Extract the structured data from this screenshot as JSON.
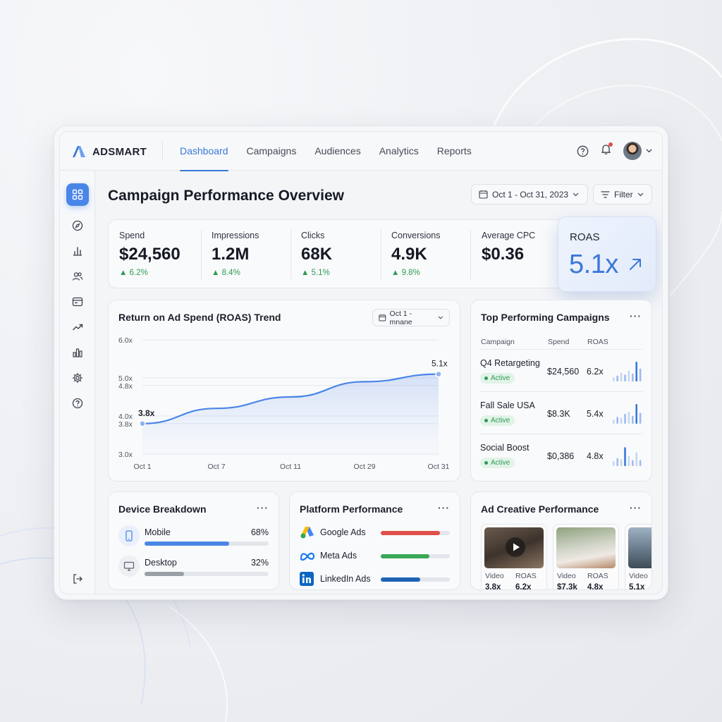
{
  "brand": {
    "name": "ADSMART",
    "accent": "#3a78d8"
  },
  "nav": {
    "items": [
      {
        "label": "Dashboard",
        "active": true
      },
      {
        "label": "Campaigns",
        "active": false
      },
      {
        "label": "Audiences",
        "active": false
      },
      {
        "label": "Analytics",
        "active": false
      },
      {
        "label": "Reports",
        "active": false
      }
    ],
    "icons": [
      "help-icon",
      "bell-icon",
      "avatar",
      "chevron-down-icon"
    ]
  },
  "sidebar": {
    "icons": [
      "grid-icon",
      "compass-icon",
      "bar-chart-icon",
      "users-icon",
      "card-icon",
      "trending-up-icon",
      "stats-icon",
      "gear-icon",
      "help-icon",
      "logout-icon"
    ]
  },
  "page": {
    "title": "Campaign Performance Overview",
    "date_range": "Oct 1 - Oct 31, 2023",
    "filter_label": "Filter"
  },
  "kpis": [
    {
      "label": "Spend",
      "value": "$24,560",
      "delta": "6.2%"
    },
    {
      "label": "Impressions",
      "value": "1.2M",
      "delta": "8.4%"
    },
    {
      "label": "Clicks",
      "value": "68K",
      "delta": "5.1%"
    },
    {
      "label": "Conversions",
      "value": "4.9K",
      "delta": "9.8%"
    },
    {
      "label": "Average CPC",
      "value": "$0.36",
      "delta": ""
    }
  ],
  "roas": {
    "label": "ROAS",
    "value": "5.1x"
  },
  "trend": {
    "title": "Return on Ad Spend (ROAS) Trend",
    "date_pill": "Oct 1 - mnane",
    "start_label": "3.8x",
    "end_label": "5.1x"
  },
  "chart_data": {
    "type": "area",
    "x": [
      "Oct 1",
      "Oct 7",
      "Oct 11",
      "Oct 29",
      "Oct 31"
    ],
    "x_ticks": [
      "Oct 1",
      "Oct 7",
      "Oct 11",
      "Oct 29",
      "Oct 31"
    ],
    "points": [
      {
        "x": "Oct 1",
        "y": 3.8
      },
      {
        "x": "Oct 7",
        "y": 4.2
      },
      {
        "x": "Oct 11",
        "y": 4.5
      },
      {
        "x": "Oct 29",
        "y": 4.9
      },
      {
        "x": "Oct 31",
        "y": 5.1
      }
    ],
    "y_ticks": [
      6.0,
      5.0,
      4.8,
      4.0,
      3.8,
      3.0
    ],
    "y_tick_labels": [
      "6.0x",
      "5.0x",
      "4.8x",
      "4.0x",
      "3.8x",
      "3.0x"
    ],
    "ylim": [
      3.0,
      6.0
    ],
    "grid": true
  },
  "top_campaigns": {
    "title": "Top Performing Campaigns",
    "headers": [
      "Campaign",
      "Spend",
      "ROAS"
    ],
    "rows": [
      {
        "name": "Q4 Retargeting",
        "status": "Active",
        "spend": "$24,560",
        "roas": "6.2x",
        "bars": [
          0.2,
          0.3,
          0.45,
          0.35,
          0.55,
          0.4,
          1.0,
          0.65
        ]
      },
      {
        "name": "Fall Sale USA",
        "status": "Active",
        "spend": "$8.3K",
        "roas": "5.4x",
        "bars": [
          0.2,
          0.35,
          0.3,
          0.5,
          0.6,
          0.4,
          1.0,
          0.55
        ]
      },
      {
        "name": "Social Boost",
        "status": "Active",
        "spend": "$0,386",
        "roas": "4.8x",
        "bars": [
          0.25,
          0.4,
          0.35,
          0.95,
          0.5,
          0.3,
          0.7,
          0.3
        ]
      }
    ]
  },
  "devices": {
    "title": "Device Breakdown",
    "rows": [
      {
        "name": "Mobile",
        "pct": "68%",
        "share": 0.68,
        "color": "#4a86e8",
        "icon": "mobile-icon"
      },
      {
        "name": "Desktop",
        "pct": "32%",
        "share": 0.32,
        "color": "#9aa0a8",
        "icon": "desktop-icon"
      }
    ]
  },
  "platforms": {
    "title": "Platform Performance",
    "rows": [
      {
        "name": "Google Ads",
        "share": 0.86,
        "color": "#e0504a",
        "icon": "google-ads-icon"
      },
      {
        "name": "Meta Ads",
        "share": 0.7,
        "color": "#3aa757",
        "icon": "meta-icon"
      },
      {
        "name": "LinkedIn Ads",
        "share": 0.57,
        "color": "#1d63b4",
        "icon": "linkedin-icon"
      }
    ]
  },
  "creatives": {
    "title": "Ad Creative Performance",
    "items": [
      {
        "label1": "Video",
        "val1": "3.8x",
        "label2": "ROAS",
        "val2": "6.2x"
      },
      {
        "label1": "Video",
        "val1": "$7.3k",
        "label2": "ROAS",
        "val2": "4.8x"
      },
      {
        "label1": "Video",
        "val1": "5.1x",
        "label2": "",
        "val2": ""
      }
    ]
  }
}
